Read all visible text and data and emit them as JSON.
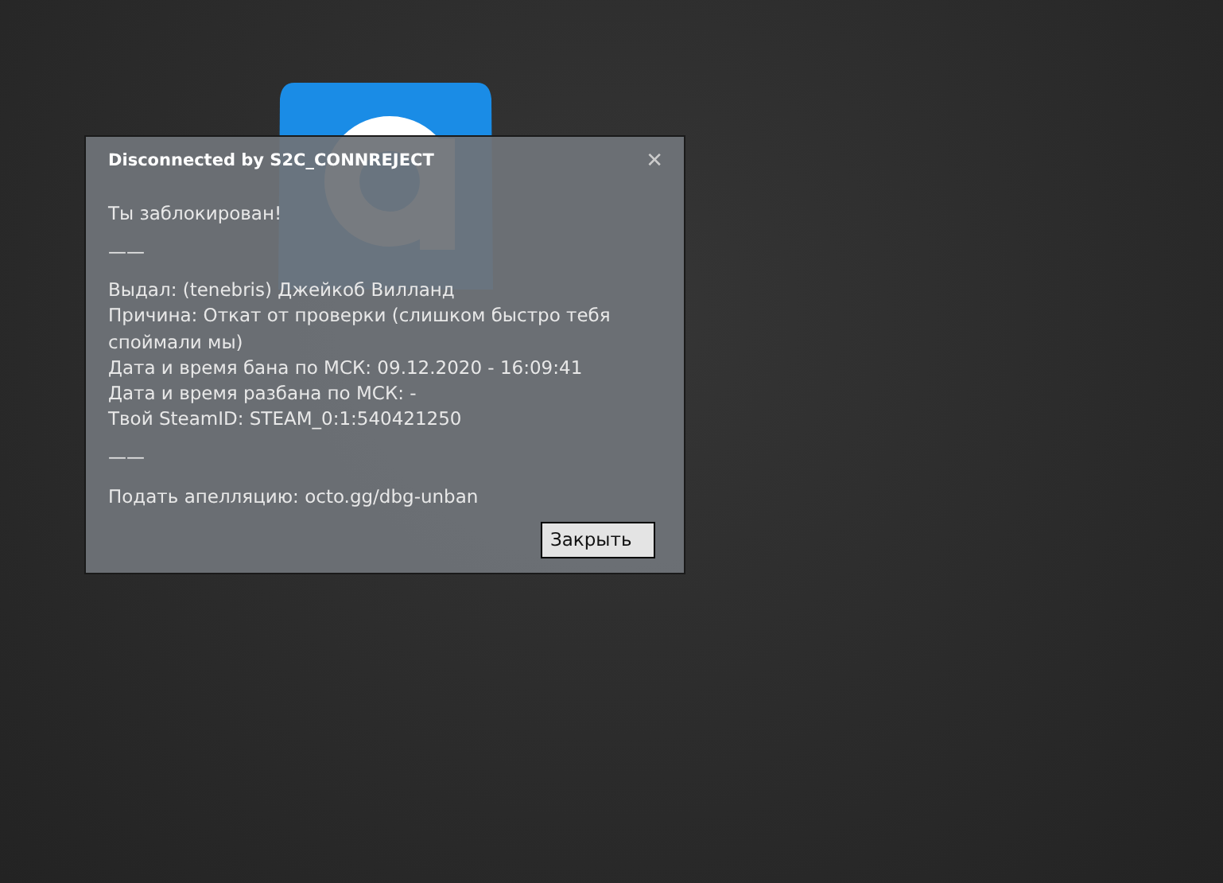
{
  "dialog": {
    "title": "Disconnected by S2C_CONNREJECT",
    "close": "✕",
    "blocks": [
      [
        "Ты заблокирован!"
      ],
      [
        "——"
      ],
      [
        "Выдал: (tenebris) Джейкоб Вилланд",
        "Причина: Откат от проверки (слишком быстро тебя споймали мы)",
        "Дата и время бана по МСК: 09.12.2020 - 16:09:41",
        "Дата и время разбана по МСК: -",
        "Твой SteamID: STEAM_0:1:540421250"
      ],
      [
        "——"
      ],
      [
        "Подать апелляцию: octo.gg/dbg-unban"
      ]
    ],
    "buttons": [
      "Закрыть"
    ]
  }
}
